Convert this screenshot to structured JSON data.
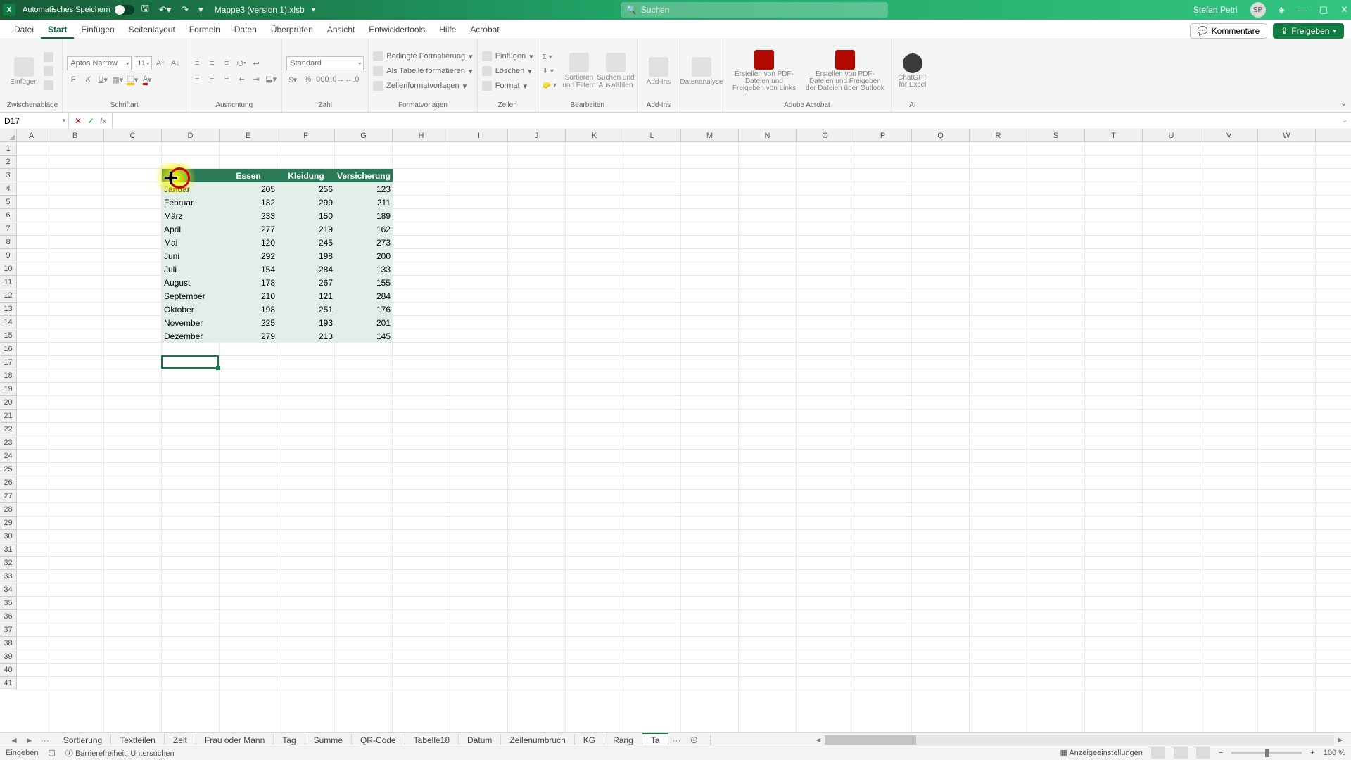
{
  "titlebar": {
    "autosave": "Automatisches Speichern",
    "filename": "Mappe3 (version 1).xlsb",
    "search_placeholder": "Suchen",
    "user": "Stefan Petri"
  },
  "menu": {
    "tabs": [
      "Datei",
      "Start",
      "Einfügen",
      "Seitenlayout",
      "Formeln",
      "Daten",
      "Überprüfen",
      "Ansicht",
      "Entwicklertools",
      "Hilfe",
      "Acrobat"
    ],
    "active": 1,
    "comments": "Kommentare",
    "share": "Freigeben"
  },
  "ribbon": {
    "clipboard": {
      "paste": "Einfügen",
      "label": "Zwischenablage"
    },
    "font": {
      "name": "Aptos Narrow",
      "size": "11",
      "label": "Schriftart"
    },
    "alignment_label": "Ausrichtung",
    "number": {
      "format": "Standard",
      "label": "Zahl"
    },
    "styles": {
      "cond": "Bedingte Formatierung",
      "table": "Als Tabelle formatieren",
      "cell": "Zellenformatvorlagen",
      "label": "Formatvorlagen"
    },
    "cells": {
      "insert": "Einfügen",
      "delete": "Löschen",
      "format": "Format",
      "label": "Zellen"
    },
    "editing": {
      "sort": "Sortieren und Filtern",
      "find": "Suchen und Auswählen",
      "label": "Bearbeiten"
    },
    "addins": {
      "btn": "Add-Ins",
      "label": "Add-Ins"
    },
    "data_analysis": "Datenanalyse",
    "acrobat": {
      "b1": "Erstellen von PDF-Dateien und Freigeben von Links",
      "b2": "Erstellen von PDF-Dateien und Freigeben der Dateien über Outlook",
      "label": "Adobe Acrobat"
    },
    "ai": {
      "btn": "ChatGPT for Excel",
      "label": "AI"
    }
  },
  "formula": {
    "namebox": "D17"
  },
  "colwidths": {
    "A": 42,
    "B": 82,
    "C": 82,
    "D": 82,
    "E": 82,
    "F": 82,
    "G": 82,
    "other": 82
  },
  "rows": 41,
  "columns": [
    "A",
    "B",
    "C",
    "D",
    "E",
    "F",
    "G",
    "H",
    "I",
    "J",
    "K",
    "L",
    "M",
    "N",
    "O",
    "P",
    "Q",
    "R",
    "S",
    "T",
    "U",
    "V",
    "W"
  ],
  "chart_data": {
    "type": "table",
    "title": "",
    "columns": [
      "",
      "Essen",
      "Kleidung",
      "Versicherung"
    ],
    "rows": [
      [
        "Januar",
        205,
        256,
        123
      ],
      [
        "Februar",
        182,
        299,
        211
      ],
      [
        "März",
        233,
        150,
        189
      ],
      [
        "April",
        277,
        219,
        162
      ],
      [
        "Mai",
        120,
        245,
        273
      ],
      [
        "Juni",
        292,
        198,
        200
      ],
      [
        "Juli",
        154,
        284,
        133
      ],
      [
        "August",
        178,
        267,
        155
      ],
      [
        "September",
        210,
        121,
        284
      ],
      [
        "Oktober",
        198,
        251,
        176
      ],
      [
        "November",
        225,
        193,
        201
      ],
      [
        "Dezember",
        279,
        213,
        145
      ]
    ]
  },
  "selection": "D17",
  "sheets": {
    "tabs": [
      "Sortierung",
      "Textteilen",
      "Zeit",
      "Frau oder Mann",
      "Tag",
      "Summe",
      "QR-Code",
      "Tabelle18",
      "Datum",
      "Zeilenumbruch",
      "KG",
      "Rang",
      "Ta"
    ],
    "active": 12
  },
  "status": {
    "mode": "Eingeben",
    "access": "Barrierefreiheit: Untersuchen",
    "display": "Anzeigeeinstellungen",
    "zoom": "100 %"
  }
}
